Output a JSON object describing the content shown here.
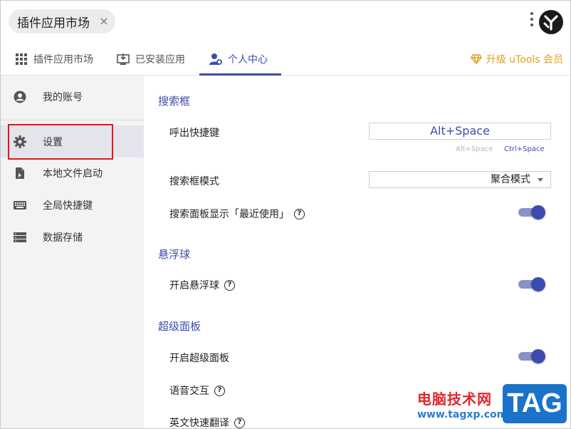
{
  "header": {
    "chip_label": "插件应用市场",
    "chip_close": "×",
    "logo": "utools-logo"
  },
  "tabs": [
    {
      "label": "插件应用市场",
      "icon": "grid-icon",
      "active": false
    },
    {
      "label": "已安装应用",
      "icon": "download-monitor-icon",
      "active": false
    },
    {
      "label": "个人中心",
      "icon": "user-gear-icon",
      "active": true
    }
  ],
  "upgrade": {
    "label": "升级 uTools 会员",
    "icon": "diamond-icon",
    "color": "#e0a020"
  },
  "sidebar": {
    "items": [
      {
        "label": "我的账号",
        "icon": "account-circle-icon"
      },
      {
        "label": "设置",
        "icon": "gear-icon",
        "selected": true
      },
      {
        "label": "本地文件启动",
        "icon": "file-launch-icon"
      },
      {
        "label": "全局快捷键",
        "icon": "keyboard-icon"
      },
      {
        "label": "数据存储",
        "icon": "storage-icon"
      }
    ]
  },
  "main": {
    "sections": [
      {
        "title": "搜索框"
      },
      {
        "title": "悬浮球"
      },
      {
        "title": "超级面板"
      }
    ],
    "search": {
      "hotkey_label": "呼出快捷键",
      "hotkey_value": "Alt+Space",
      "hotkey_hint_1": "Alt+Space",
      "hotkey_hint_2": "Ctrl+Space",
      "mode_label": "搜索框模式",
      "mode_value": "聚合模式",
      "recent_label": "搜索面板显示「最近使用」",
      "recent_on": true
    },
    "floatball": {
      "enable_label": "开启悬浮球",
      "enable_on": true
    },
    "superpanel": {
      "enable_label": "开启超级面板",
      "enable_on": true,
      "voice_label": "语音交互",
      "translate_label": "英文快速翻译"
    }
  },
  "watermark": {
    "site_name": "电脑技术网",
    "url": "www.tagxp.com",
    "tag": "TAG"
  },
  "colors": {
    "accent": "#3b4bb0",
    "highlight": "#e0151b",
    "sidebar_bg": "#f3f3f3"
  }
}
